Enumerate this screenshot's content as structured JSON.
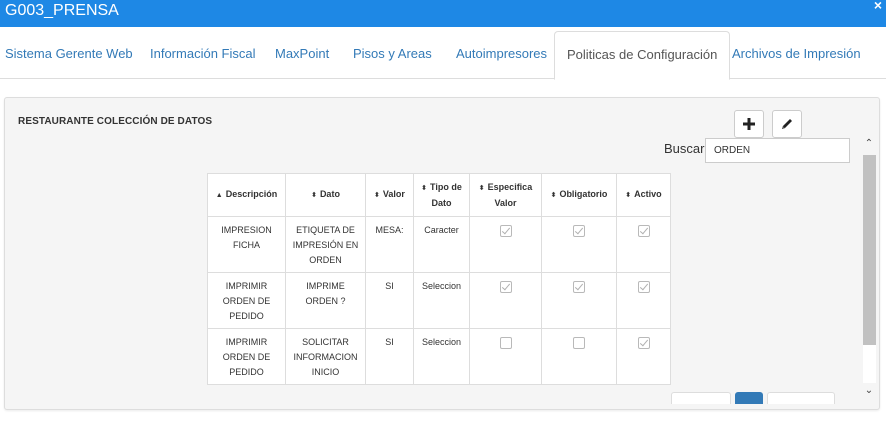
{
  "window": {
    "title": "G003_PRENSA",
    "close_glyph": "×"
  },
  "tabs": [
    {
      "label": "Sistema Gerente Web"
    },
    {
      "label": "Información Fiscal"
    },
    {
      "label": "MaxPoint"
    },
    {
      "label": "Pisos y Areas"
    },
    {
      "label": "Autoimpresores"
    },
    {
      "label": "Politicas de Configuración",
      "active": true
    },
    {
      "label": "Archivos de Impresión"
    }
  ],
  "panel": {
    "title": "RESTAURANTE COLECCIÓN DE DATOS",
    "add_icon": "plus-icon",
    "edit_icon": "pencil-icon"
  },
  "search": {
    "label": "Buscar:",
    "value": "ORDEN"
  },
  "table": {
    "headers": [
      "Descripción",
      "Dato",
      "Valor",
      "Tipo de Dato",
      "Especifica Valor",
      "Obligatorio",
      "Activo"
    ],
    "sort_glyphs": {
      "asc": "▲",
      "both": "⬍"
    },
    "rows": [
      {
        "descripcion": "IMPRESION FICHA",
        "dato": "ETIQUETA DE IMPRESIÓN EN ORDEN",
        "valor": "MESA:",
        "tipo": "Caracter",
        "especifica": true,
        "obligatorio": true,
        "activo": true
      },
      {
        "descripcion": "IMPRIMIR ORDEN DE PEDIDO",
        "dato": "IMPRIME ORDEN ?",
        "valor": "SI",
        "tipo": "Seleccion",
        "especifica": true,
        "obligatorio": true,
        "activo": true
      },
      {
        "descripcion": "IMPRIMIR ORDEN DE PEDIDO",
        "dato": "SOLICITAR INFORMACION INICIO",
        "valor": "SI",
        "tipo": "Seleccion",
        "especifica": false,
        "obligatorio": false,
        "activo": true
      }
    ]
  },
  "scrollbar": {
    "up": "⌃",
    "down": "⌄"
  },
  "colors": {
    "titlebar": "#1e88e5",
    "tab_link": "#337ab7",
    "pager_active": "#337ab7"
  }
}
